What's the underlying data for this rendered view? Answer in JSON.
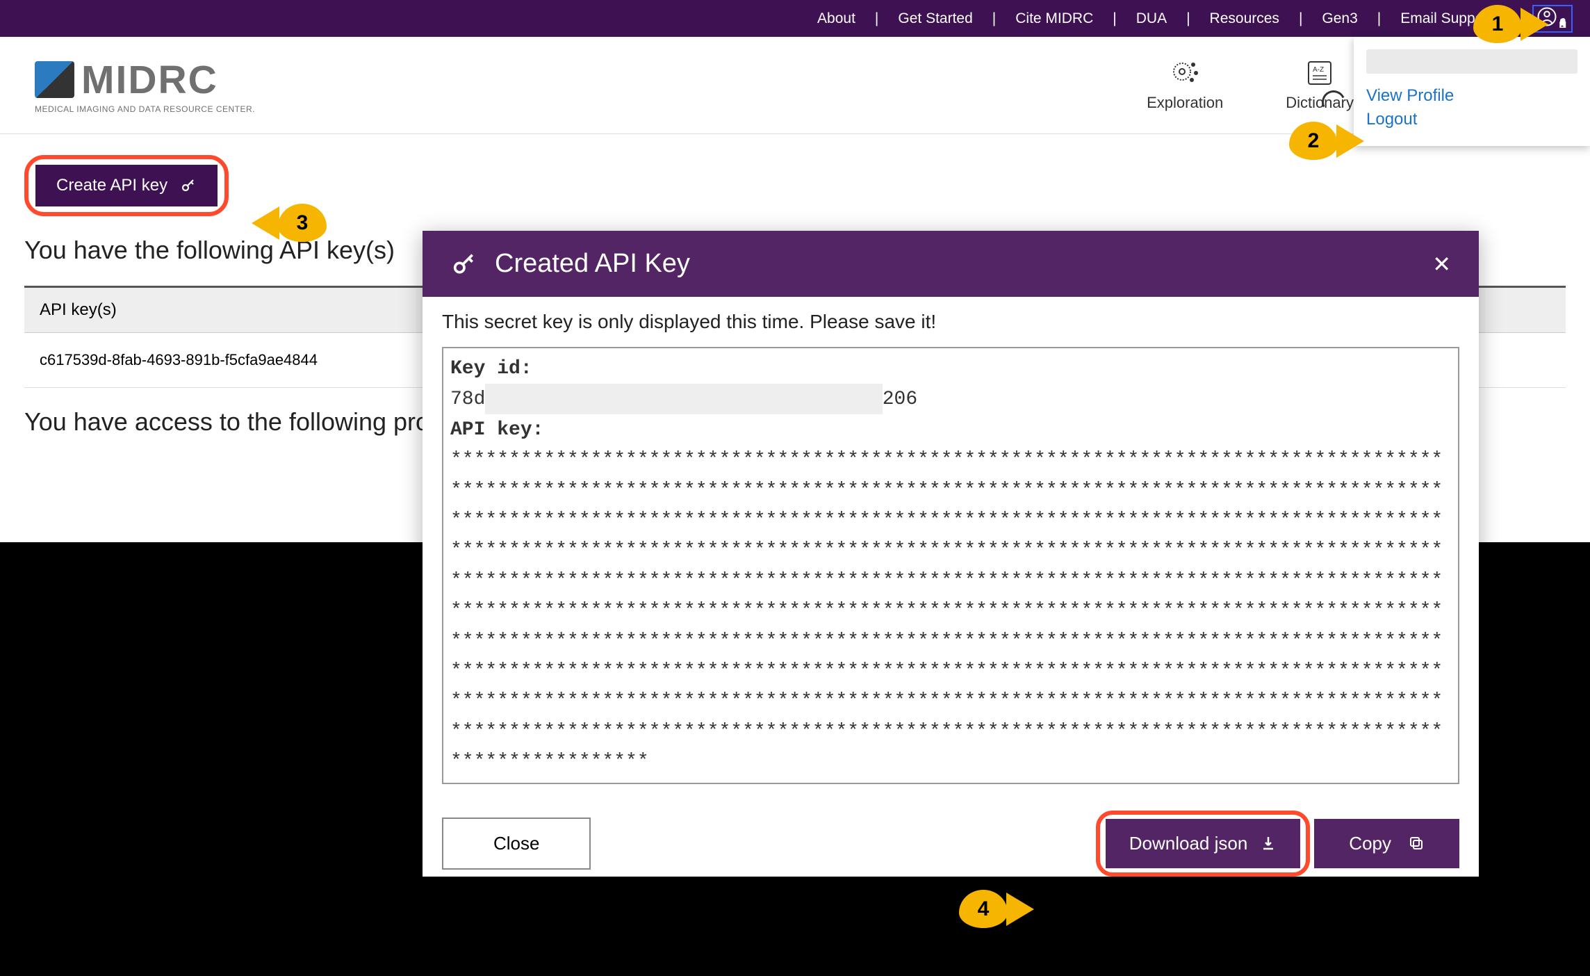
{
  "topnav": {
    "items": [
      "About",
      "Get Started",
      "Cite MIDRC",
      "DUA",
      "Resources",
      "Gen3",
      "Email Support"
    ]
  },
  "logo": {
    "text": "MIDRC",
    "subtitle": "MEDICAL IMAGING AND DATA RESOURCE CENTER."
  },
  "tiles": {
    "exploration": "Exploration",
    "dictionary": "Dictionary"
  },
  "dropdown": {
    "view_profile": "View Profile",
    "logout": "Logout"
  },
  "page": {
    "create_button": "Create API key",
    "heading1": "You have the following API key(s)",
    "table_header": "API key(s)",
    "api_key_row": "c617539d-8fab-4693-891b-f5cfa9ae4844",
    "heading2": "You have access to the following project(s)"
  },
  "modal": {
    "title": "Created API Key",
    "message": "This secret key is only displayed this time. Please save it!",
    "key_id_label": "Key id:",
    "key_id_prefix": "78d",
    "key_id_suffix": "206",
    "api_key_label": "API key:",
    "api_key_mask": "***************************************************************************************************************************************************************************************************************************************************************************************************************************************************************************************************************************************************************************************************************************************************************************************************************************************************************************************************************************************************************************************************************************************************************************************************",
    "close": "Close",
    "download": "Download json",
    "copy": "Copy"
  },
  "callouts": {
    "b1": "1",
    "b2": "2",
    "b3": "3",
    "b4": "4"
  }
}
